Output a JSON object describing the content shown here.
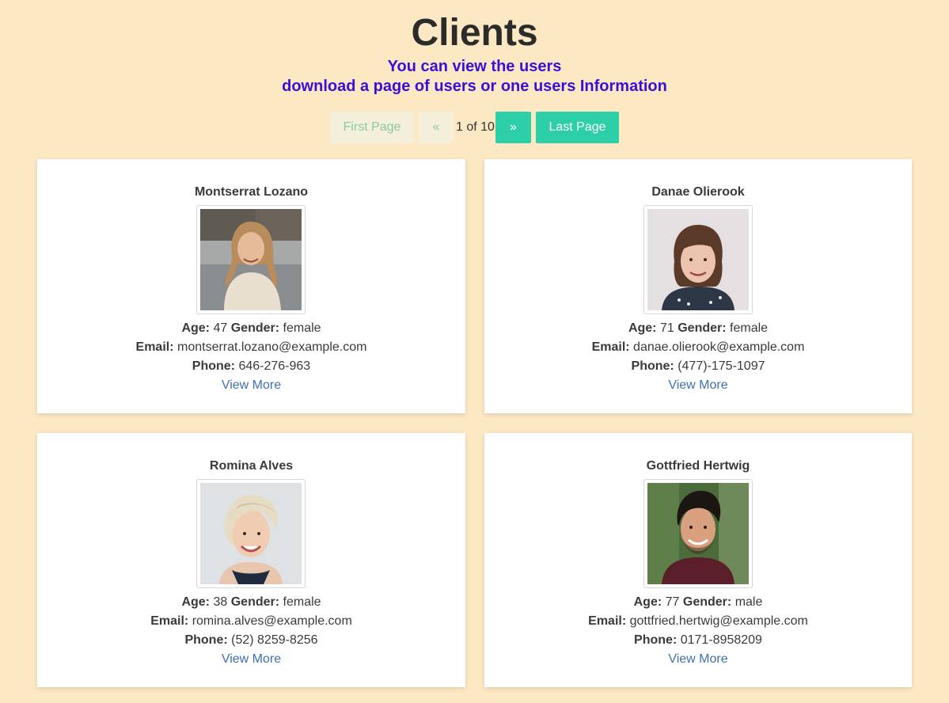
{
  "header": {
    "title": "Clients",
    "subtitle_line1": "You can view the users",
    "subtitle_line2": "download a page of users or one users Information"
  },
  "pagination": {
    "first_label": "First Page",
    "prev_label": "«",
    "page_info": "1 of 10",
    "next_label": "»",
    "last_label": "Last Page"
  },
  "labels": {
    "age": "Age:",
    "gender": "Gender:",
    "email": "Email:",
    "phone": "Phone:",
    "view_more": "View More"
  },
  "clients": [
    {
      "name": "Montserrat Lozano",
      "age": "47",
      "gender": "female",
      "email": "montserrat.lozano@example.com",
      "phone": "646-276-963",
      "avatar_icon": "avatar-photo-woman-blonde-outdoor"
    },
    {
      "name": "Danae Olierook",
      "age": "71",
      "gender": "female",
      "email": "danae.olierook@example.com",
      "phone": "(477)-175-1097",
      "avatar_icon": "avatar-photo-woman-brown-hair"
    },
    {
      "name": "Romina Alves",
      "age": "38",
      "gender": "female",
      "email": "romina.alves@example.com",
      "phone": "(52) 8259-8256",
      "avatar_icon": "avatar-photo-woman-short-blonde"
    },
    {
      "name": "Gottfried Hertwig",
      "age": "77",
      "gender": "male",
      "email": "gottfried.hertwig@example.com",
      "phone": "0171-8958209",
      "avatar_icon": "avatar-photo-man-dark-hair"
    }
  ],
  "colors": {
    "background": "#fde8c4",
    "subtitle": "#3a0fd9",
    "button_active": "#2ccfa8",
    "button_disabled": "#f3efdb",
    "link": "#3d6fb5"
  }
}
